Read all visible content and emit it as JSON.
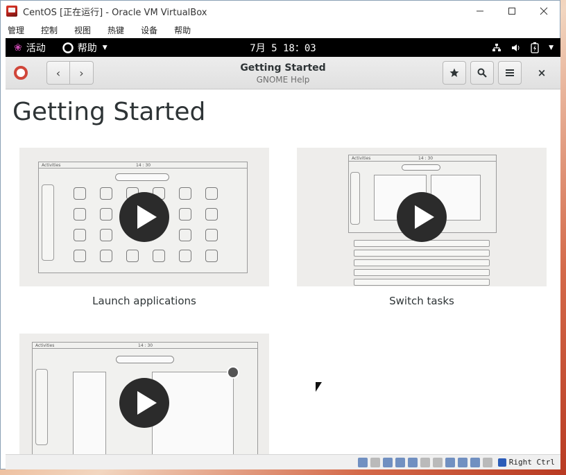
{
  "vbox": {
    "title": "CentOS [正在运行] - Oracle VM VirtualBox",
    "menu": [
      "管理",
      "控制",
      "视图",
      "热键",
      "设备",
      "帮助"
    ],
    "minimize_icon": "minimize-icon",
    "maximize_icon": "maximize-icon",
    "close_icon": "close-icon",
    "statusbar": {
      "host_key": "Right Ctrl"
    }
  },
  "gnome_topbar": {
    "activities": "活动",
    "app_menu": "帮助",
    "clock": "7月 5  18：03"
  },
  "help_window": {
    "title": "Getting Started",
    "subtitle": "GNOME Help",
    "back_glyph": "‹",
    "forward_glyph": "›",
    "close_glyph": "×"
  },
  "page": {
    "heading": "Getting Started",
    "videos": [
      {
        "label": "Launch applications",
        "mock_clock": "14 : 30",
        "mock_label": "Activities"
      },
      {
        "label": "Switch tasks",
        "mock_clock": "14 : 30",
        "mock_label": "Activities"
      },
      {
        "label": "",
        "mock_clock": "14 : 30",
        "mock_label": "Activities"
      }
    ]
  },
  "colors": {
    "accent_red": "#d0463a",
    "topbar_bg": "#000000",
    "thumb_bg": "#eeedeb",
    "play_bg": "#2b2b2b"
  }
}
